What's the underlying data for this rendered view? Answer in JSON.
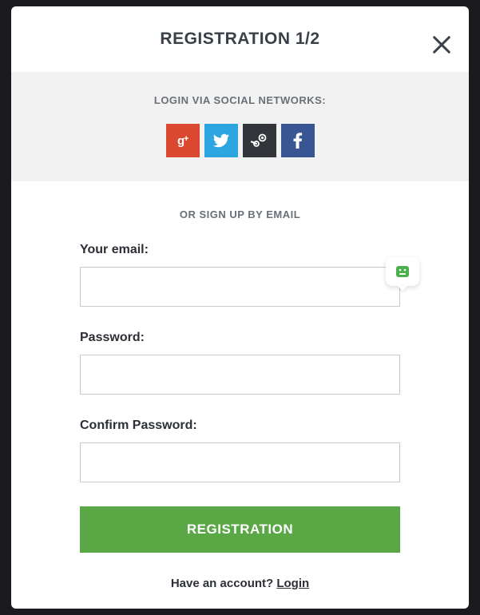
{
  "header": {
    "title": "REGISTRATION 1/2"
  },
  "social": {
    "label": "LOGIN VIA SOCIAL NETWORKS:"
  },
  "divider": "OR SIGN UP BY EMAIL",
  "form": {
    "email_label": "Your email:",
    "email_value": "",
    "password_label": "Password:",
    "password_value": "",
    "confirm_label": "Confirm Password:",
    "confirm_value": "",
    "submit_label": "REGISTRATION"
  },
  "footer": {
    "prompt": "Have an account? ",
    "login_link": "Login"
  }
}
